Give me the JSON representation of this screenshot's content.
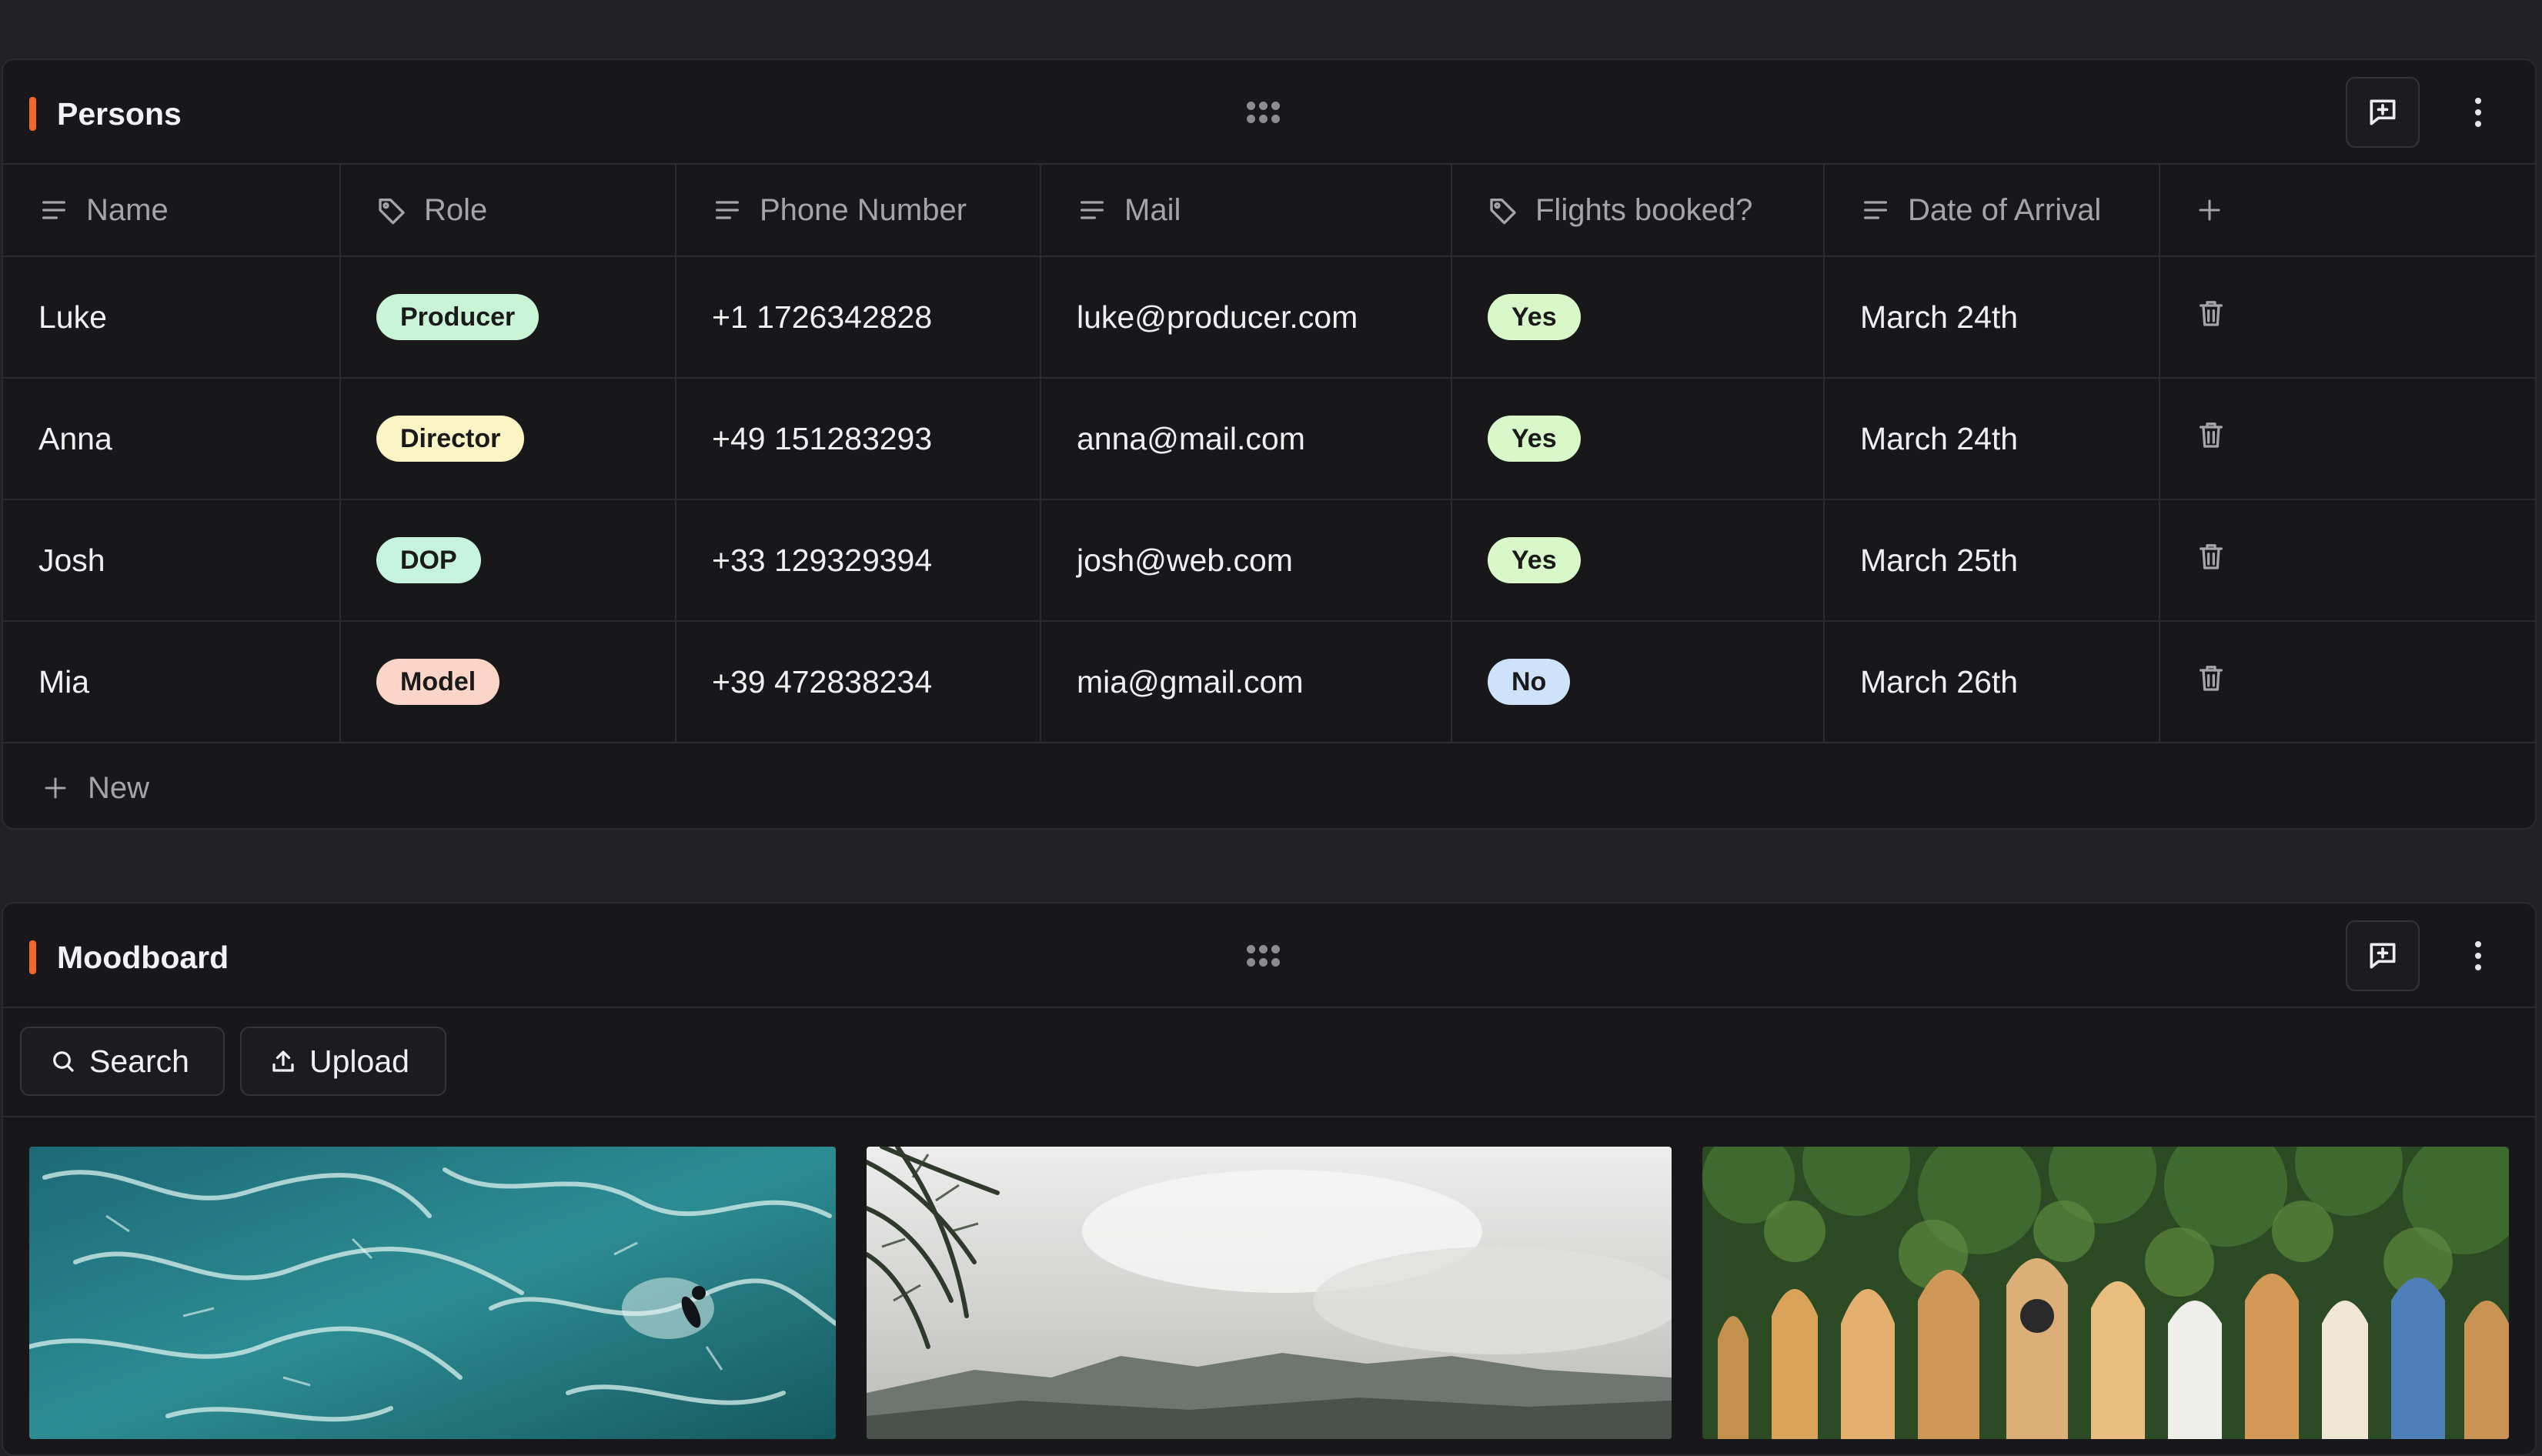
{
  "persons": {
    "title": "Persons",
    "columns": [
      {
        "label": "Name",
        "icon": "text-lines-icon"
      },
      {
        "label": "Role",
        "icon": "tag-icon"
      },
      {
        "label": "Phone Number",
        "icon": "text-lines-icon"
      },
      {
        "label": "Mail",
        "icon": "text-lines-icon"
      },
      {
        "label": "Flights booked?",
        "icon": "tag-icon"
      },
      {
        "label": "Date of Arrival",
        "icon": "text-lines-icon"
      }
    ],
    "add_column_icon": "plus-icon",
    "rows": [
      {
        "name": "Luke",
        "role": "Producer",
        "role_color": "#c9f5d6",
        "phone": "+1 1726342828",
        "mail": "luke@producer.com",
        "flights": "Yes",
        "flights_color": "#d8f8c9",
        "arrival": "March 24th"
      },
      {
        "name": "Anna",
        "role": "Director",
        "role_color": "#fbf5c6",
        "phone": "+49 151283293",
        "mail": "anna@mail.com",
        "flights": "Yes",
        "flights_color": "#d8f8c9",
        "arrival": "March 24th"
      },
      {
        "name": "Josh",
        "role": "DOP",
        "role_color": "#c5f3df",
        "phone": "+33 129329394",
        "mail": "josh@web.com",
        "flights": "Yes",
        "flights_color": "#d8f8c9",
        "arrival": "March 25th"
      },
      {
        "name": "Mia",
        "role": "Model",
        "role_color": "#fbd6c8",
        "phone": "+39 472838234",
        "mail": "mia@gmail.com",
        "flights": "No",
        "flights_color": "#cfe2fb",
        "arrival": "March 26th"
      }
    ],
    "new_label": "New"
  },
  "moodboard": {
    "title": "Moodboard",
    "search_label": "Search",
    "upload_label": "Upload"
  },
  "colors": {
    "accent": "#f2672c",
    "background": "#222224",
    "panel": "#18181a"
  }
}
